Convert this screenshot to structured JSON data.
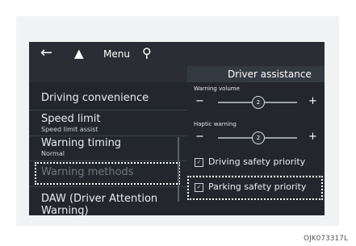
{
  "topbar": {
    "back_icon": "arrow-left-icon",
    "home_icon": "home-icon",
    "menu_label": "Menu",
    "search_icon": "search-icon"
  },
  "header": {
    "title": "Driver assistance"
  },
  "left_menu": {
    "items": [
      {
        "label": "Driving convenience",
        "sub": ""
      },
      {
        "label": "Speed limit",
        "sub": "Speed limit assist"
      },
      {
        "label": "Warning timing",
        "sub": "Normal"
      },
      {
        "label": "Warning methods",
        "sub": ""
      },
      {
        "label": "DAW (Driver Attention Warning)",
        "sub": ""
      }
    ]
  },
  "right_panel": {
    "warning_volume": {
      "label": "Warning volume",
      "value": "2",
      "level": 0.5
    },
    "haptic_warning": {
      "label": "Haptic warning",
      "value": "2",
      "level": 0.5
    },
    "options": [
      {
        "label": "Driving safety priority",
        "checked": true
      },
      {
        "label": "Parking safety priority",
        "checked": true
      }
    ]
  },
  "image_code": "OJK073317L",
  "colors": {
    "screen_bg": "#23272d",
    "header_bg": "#343a42",
    "highlight": "#ffffff"
  }
}
